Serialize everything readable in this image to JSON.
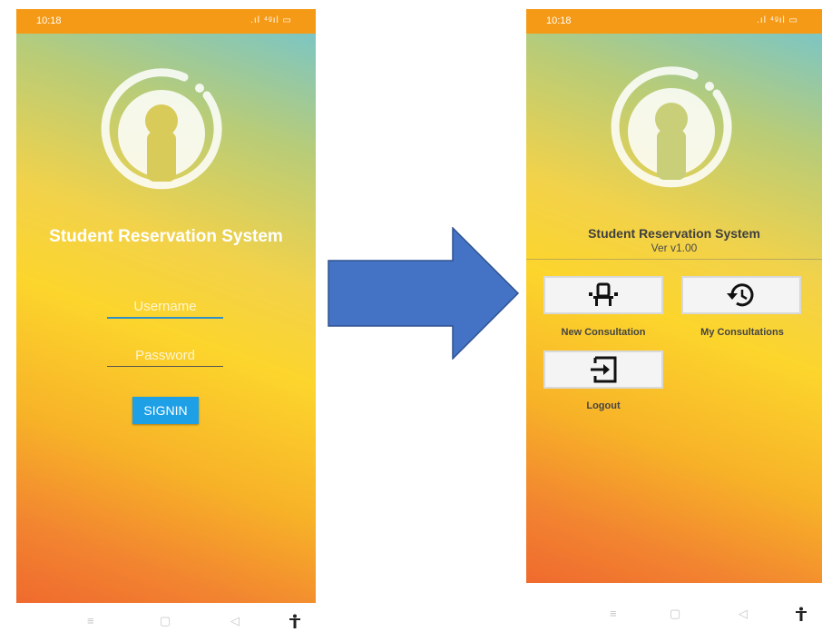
{
  "login_screen": {
    "status_time": "10:18",
    "status_icons": ".ıl ⁴ᵍıl ▭",
    "app_title": "Student Reservation System",
    "username_placeholder": "Username",
    "password_placeholder": "Password",
    "signin_label": "SIGNIN"
  },
  "menu_screen": {
    "status_time": "10:18",
    "status_icons": ".ıl ⁴ᵍıl ▭",
    "app_title": "Student Reservation System",
    "version": "Ver v1.00",
    "buttons": [
      {
        "label": "New Consultation",
        "icon": "chair-icon"
      },
      {
        "label": "My Consultations",
        "icon": "history-icon"
      },
      {
        "label": "Logout",
        "icon": "logout-icon"
      }
    ]
  },
  "nav_icons": [
    "≡",
    "▢",
    "◁",
    "🚹"
  ],
  "colors": {
    "status_bar": "#f59a16",
    "signin_button": "#1ea0e6",
    "arrow": "#4472c4",
    "gradient_top": "#7cc6c4",
    "gradient_mid": "#fcd52c",
    "gradient_bottom": "#ef6a2e"
  }
}
